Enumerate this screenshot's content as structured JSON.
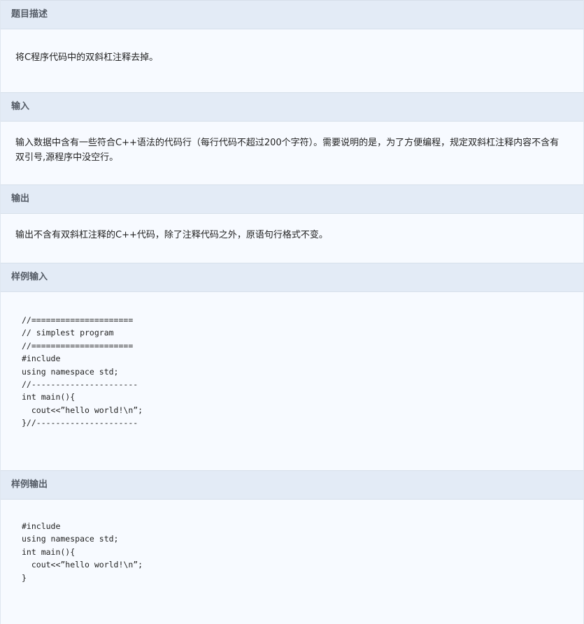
{
  "sections": {
    "description": {
      "title": "题目描述",
      "text": "将C程序代码中的双斜杠注释去掉。"
    },
    "input": {
      "title": "输入",
      "text": "输入数据中含有一些符合C++语法的代码行（每行代码不超过200个字符）。需要说明的是，为了方便编程，规定双斜杠注释内容不含有双引号,源程序中没空行。"
    },
    "output": {
      "title": "输出",
      "text": "输出不含有双斜杠注释的C++代码，除了注释代码之外，原语句行格式不变。"
    },
    "sample_input": {
      "title": "样例输入",
      "code": "//=====================\n// simplest program\n//=====================\n#include\nusing namespace std;\n//----------------------\nint main(){\n  cout<<”hello world!\\n”;\n}//---------------------"
    },
    "sample_output": {
      "title": "样例输出",
      "code": "#include\nusing namespace std;\nint main(){\n  cout<<”hello world!\\n”;\n}"
    }
  }
}
